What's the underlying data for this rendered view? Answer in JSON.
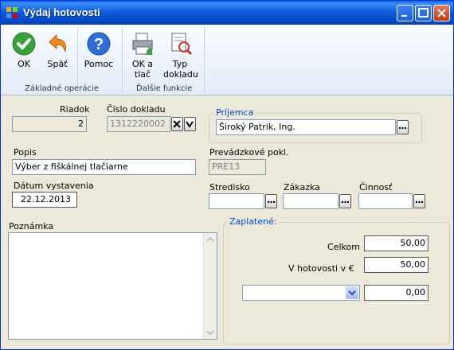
{
  "window": {
    "title": "Výdaj hotovosti"
  },
  "ribbon": {
    "ok": "OK",
    "back": "Späť",
    "help": "Pomoc",
    "group1": "Základné operácie",
    "ok_print_line1": "OK a",
    "ok_print_line2": "tlač",
    "doc_type_line1": "Typ",
    "doc_type_line2": "dokladu",
    "group2": "Ďalšie funkcie"
  },
  "form": {
    "riadok_label": "Riadok",
    "riadok_value": "2",
    "cislo_label": "Číslo dokladu",
    "cislo_value": "1312220002",
    "prijemca_legend": "Príjemca",
    "prijemca_value": "Široký Patrik, Ing.",
    "popis_label": "Popis",
    "popis_value": "Výber z fiškálnej tlačiarne",
    "prevadzkove_label": "Prevádzkové pokl.",
    "prevadzkove_value": "PRE13",
    "datum_label": "Dátum vystavenia",
    "datum_value": "22.12.2013",
    "stredisko_label": "Stredisko",
    "zakazka_label": "Zákazka",
    "cinnost_label": "Činnosť",
    "poznamka_label": "Poznámka",
    "zaplatene_legend": "Zaplatené:",
    "celkom_label": "Celkom",
    "celkom_value": "50,00",
    "hotovost_label": "V hotovosti v €",
    "hotovost_value": "50,00",
    "other_value": "0,00"
  }
}
